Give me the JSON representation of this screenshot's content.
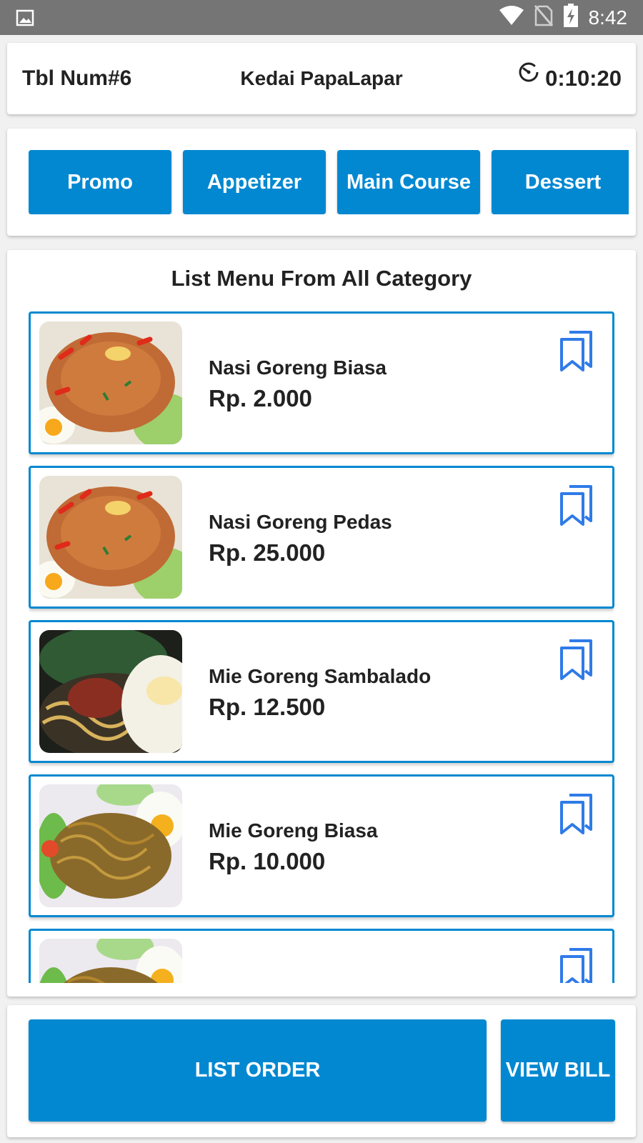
{
  "status_bar": {
    "time": "8:42",
    "icons": [
      "image-icon",
      "wifi-icon",
      "no-sim-icon",
      "battery-charging-icon"
    ]
  },
  "header": {
    "table_number": "Tbl Num#6",
    "shop_name": "Kedai PapaLapar",
    "timer": "0:10:20",
    "timer_icon": "timer-icon"
  },
  "categories": [
    {
      "label": "Promo"
    },
    {
      "label": "Appetizer"
    },
    {
      "label": "Main Course"
    },
    {
      "label": "Dessert"
    }
  ],
  "menu": {
    "title": "List Menu From All Category",
    "items": [
      {
        "name": "Nasi Goreng Biasa",
        "price": "Rp. 2.000",
        "image": "fried-rice-photo"
      },
      {
        "name": "Nasi Goreng Pedas",
        "price": "Rp. 25.000",
        "image": "fried-rice-photo"
      },
      {
        "name": "Mie Goreng Sambalado",
        "price": "Rp. 12.500",
        "image": "sambalado-noodle-photo"
      },
      {
        "name": "Mie Goreng Biasa",
        "price": "Rp. 10.000",
        "image": "fried-noodle-photo"
      },
      {
        "name": "",
        "price": "",
        "image": "fried-noodle-photo"
      }
    ],
    "bookmark_icon": "bookmark-icon"
  },
  "actions": {
    "list_order": "LIST ORDER",
    "view_bill": "VIEW BILL"
  },
  "colors": {
    "primary": "#0288d1",
    "status_bar": "#757575",
    "bookmark": "#2f7be8"
  }
}
